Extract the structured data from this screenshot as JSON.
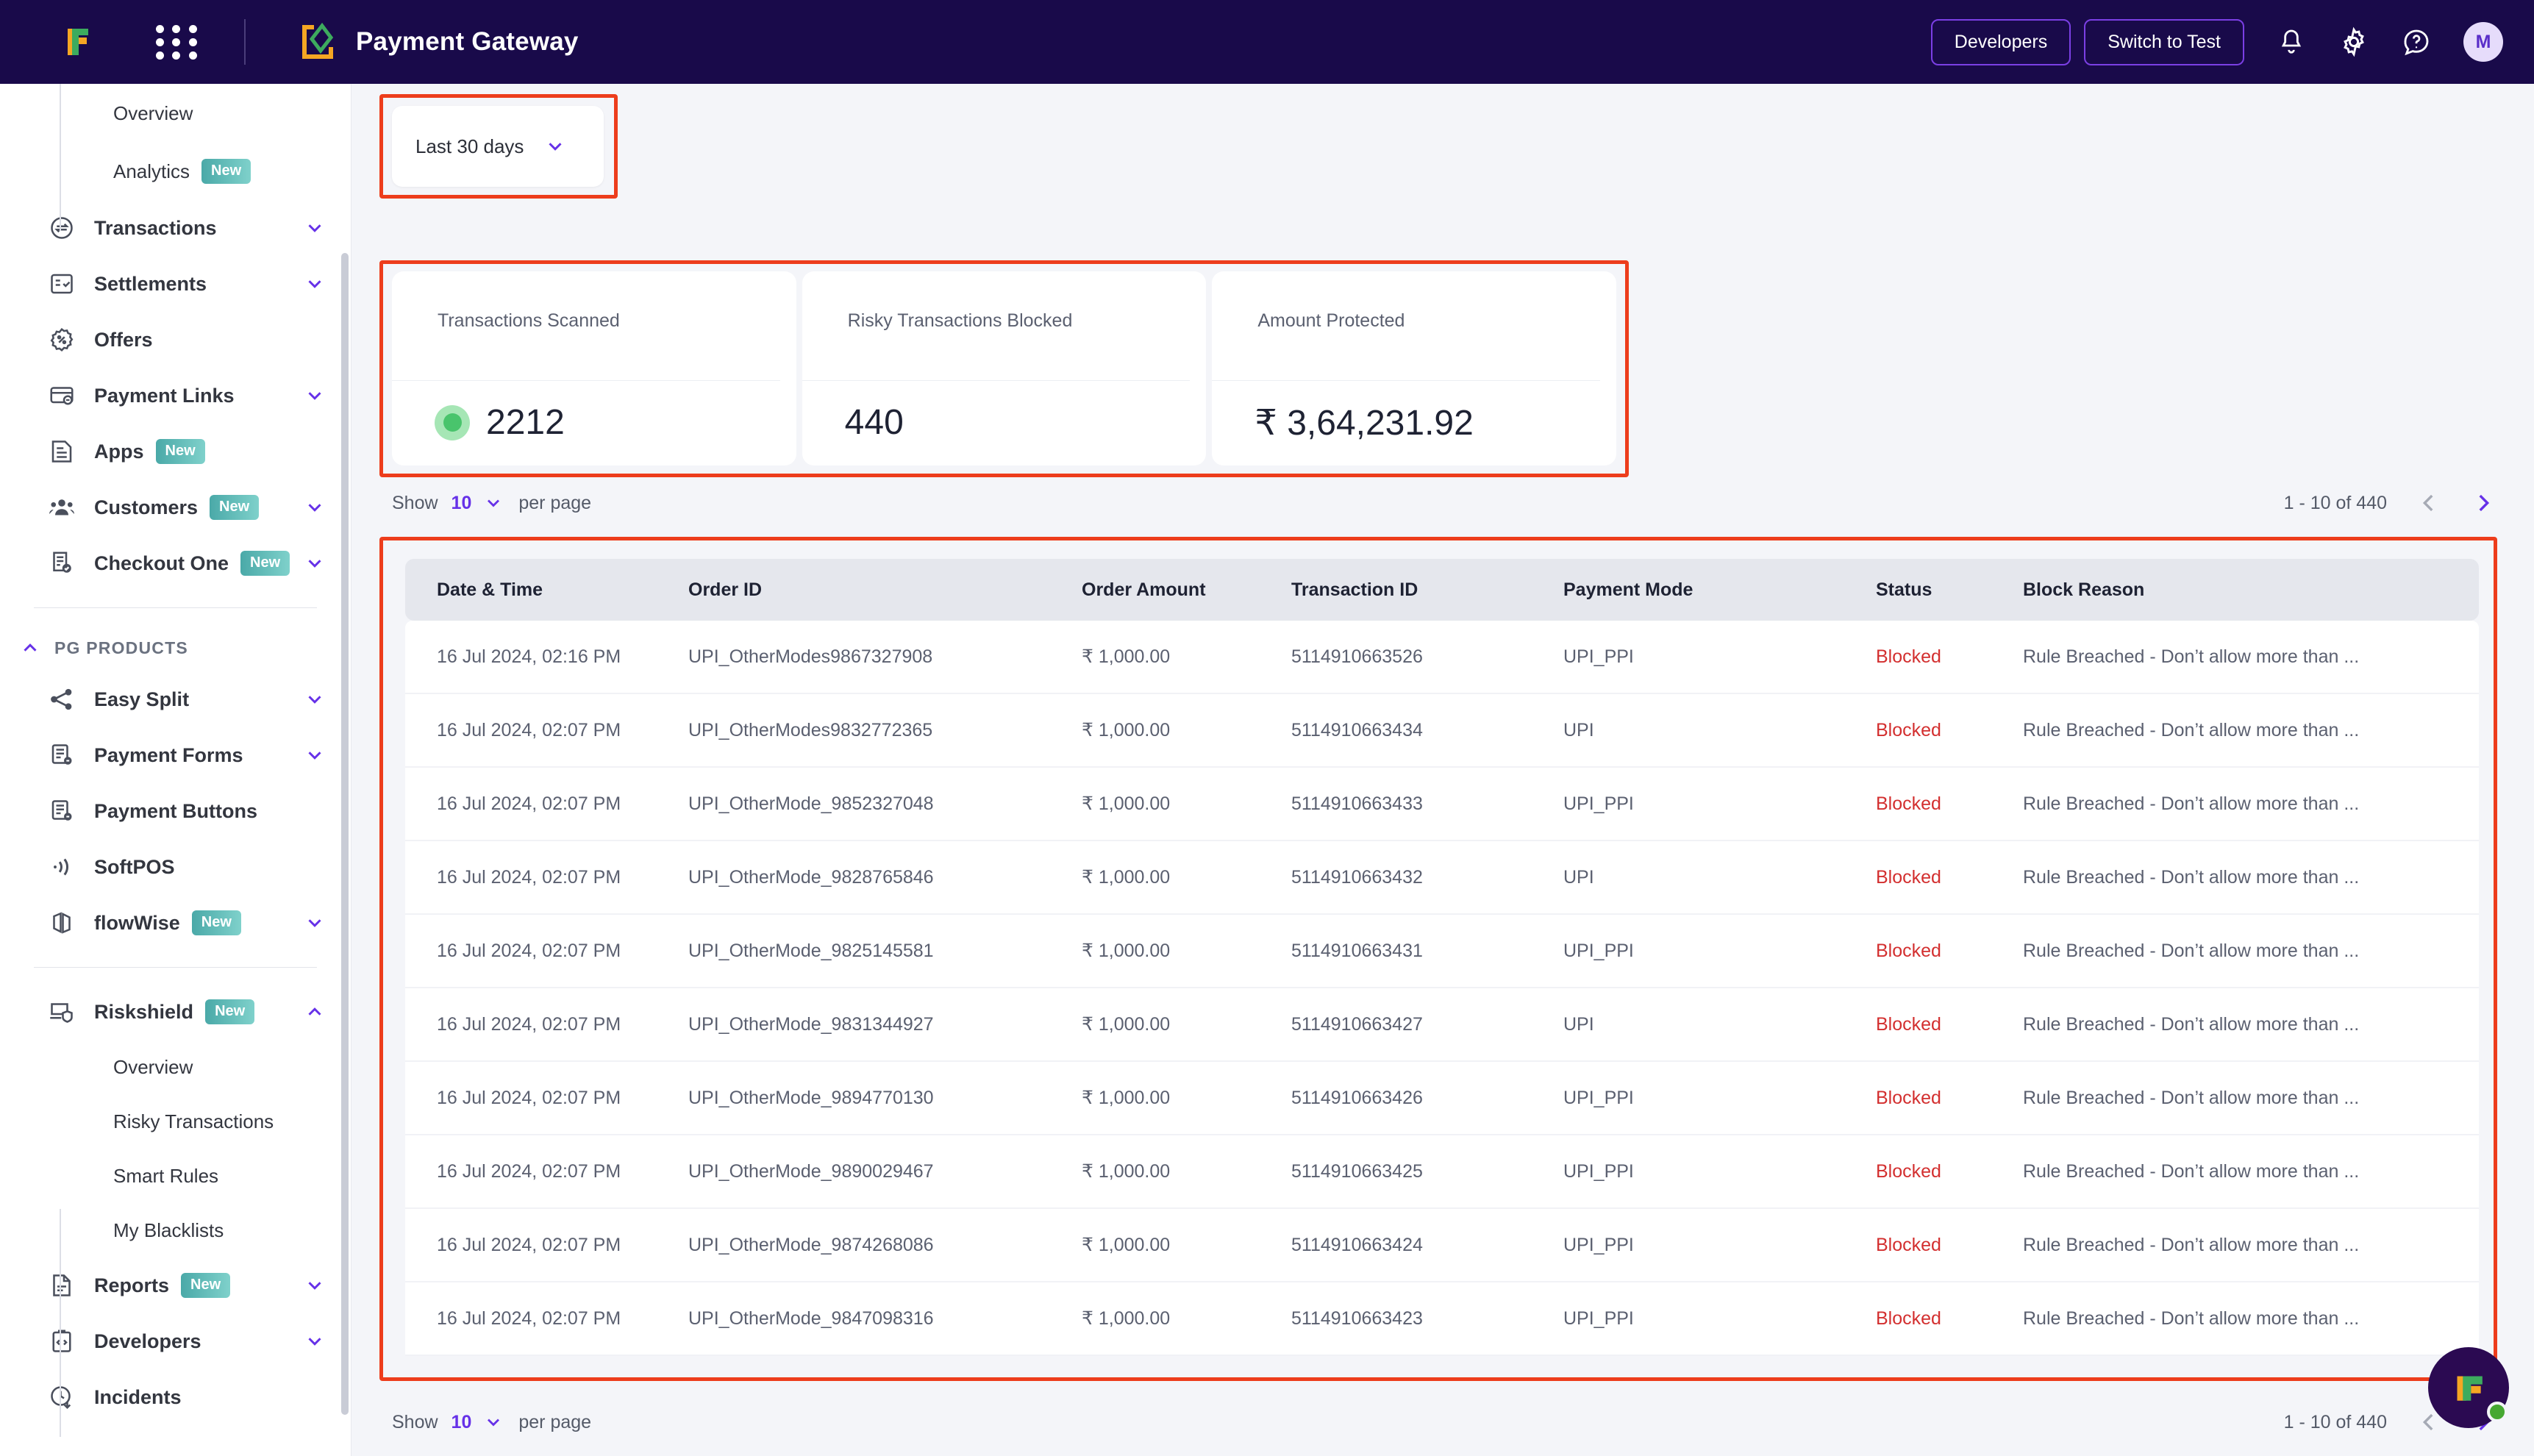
{
  "topbar": {
    "brand_icon": "flipkart-f-logo",
    "apps_grid_icon": "apps-grid-icon",
    "product_logo_icon": "payment-gateway-logo",
    "product_title": "Payment Gateway",
    "developers_label": "Developers",
    "switch_to_test_label": "Switch to Test",
    "bell_icon": "notification-bell-icon",
    "gear_icon": "settings-gear-icon",
    "help_icon": "help-question-icon",
    "avatar_initial": "M",
    "accent_purple": "#7b3fe4",
    "bar_bg": "#190A4A"
  },
  "sidebar": {
    "top_subitems": [
      {
        "label": "Overview",
        "badge": ""
      },
      {
        "label": "Analytics",
        "badge": "New"
      }
    ],
    "items": [
      {
        "label": "Transactions",
        "icon": "transactions-icon",
        "badge": "",
        "chevron": "down"
      },
      {
        "label": "Settlements",
        "icon": "settlements-icon",
        "badge": "",
        "chevron": "down"
      },
      {
        "label": "Offers",
        "icon": "offers-icon",
        "badge": "",
        "chevron": ""
      },
      {
        "label": "Payment Links",
        "icon": "payment-links-icon",
        "badge": "",
        "chevron": "down"
      },
      {
        "label": "Apps",
        "icon": "apps-icon",
        "badge": "New",
        "chevron": ""
      },
      {
        "label": "Customers",
        "icon": "customers-icon",
        "badge": "New",
        "chevron": "down"
      },
      {
        "label": "Checkout One",
        "icon": "checkout-one-icon",
        "badge": "New",
        "chevron": "down"
      }
    ],
    "section_title": "PG PRODUCTS",
    "products": [
      {
        "label": "Easy Split",
        "icon": "easy-split-icon",
        "badge": "",
        "chevron": "down"
      },
      {
        "label": "Payment Forms",
        "icon": "payment-forms-icon",
        "badge": "",
        "chevron": "down"
      },
      {
        "label": "Payment Buttons",
        "icon": "payment-buttons-icon",
        "badge": "",
        "chevron": ""
      },
      {
        "label": "SoftPOS",
        "icon": "softpos-icon",
        "badge": "",
        "chevron": ""
      },
      {
        "label": "flowWise",
        "icon": "flowwise-icon",
        "badge": "New",
        "chevron": "down"
      }
    ],
    "riskshield": {
      "label": "Riskshield",
      "icon": "riskshield-icon",
      "badge": "New",
      "chevron": "up"
    },
    "riskshield_subitems": [
      {
        "label": "Overview"
      },
      {
        "label": "Risky Transactions"
      },
      {
        "label": "Smart Rules"
      },
      {
        "label": "My Blacklists"
      }
    ],
    "bottom_items": [
      {
        "label": "Reports",
        "icon": "reports-icon",
        "badge": "New",
        "chevron": "down"
      },
      {
        "label": "Developers",
        "icon": "developers-icon",
        "badge": "",
        "chevron": "down"
      },
      {
        "label": "Incidents",
        "icon": "incidents-icon",
        "badge": "",
        "chevron": ""
      }
    ]
  },
  "main": {
    "date_filter": {
      "label": "Last 30 days",
      "chevron_icon": "chevron-down-icon"
    },
    "stats": [
      {
        "title": "Transactions Scanned",
        "value": "2212",
        "has_dot": true,
        "dot_color": "#49c46c"
      },
      {
        "title": "Risky Transactions Blocked",
        "value": "440",
        "has_dot": false
      },
      {
        "title": "Amount Protected",
        "value": "₹ 3,64,231.92",
        "has_dot": false
      }
    ],
    "pagination": {
      "show_label": "Show",
      "per_page_value": "10",
      "per_page_label": "per page",
      "range_label": "1 - 10 of 440",
      "prev_icon": "chevron-left-icon",
      "next_icon": "chevron-right-icon"
    },
    "table": {
      "columns": [
        "Date & Time",
        "Order ID",
        "Order Amount",
        "Transaction ID",
        "Payment Mode",
        "Status",
        "Block Reason"
      ],
      "rows": [
        {
          "datetime": "16 Jul 2024, 02:16 PM",
          "order_id": "UPI_OtherModes9867327908",
          "amount": "₹ 1,000.00",
          "txn_id": "5114910663526",
          "mode": "UPI_PPI",
          "status": "Blocked",
          "reason": "Rule Breached - Don’t allow more than ..."
        },
        {
          "datetime": "16 Jul 2024, 02:07 PM",
          "order_id": "UPI_OtherModes9832772365",
          "amount": "₹ 1,000.00",
          "txn_id": "5114910663434",
          "mode": "UPI",
          "status": "Blocked",
          "reason": "Rule Breached - Don’t allow more than ..."
        },
        {
          "datetime": "16 Jul 2024, 02:07 PM",
          "order_id": "UPI_OtherMode_9852327048",
          "amount": "₹ 1,000.00",
          "txn_id": "5114910663433",
          "mode": "UPI_PPI",
          "status": "Blocked",
          "reason": "Rule Breached - Don’t allow more than ..."
        },
        {
          "datetime": "16 Jul 2024, 02:07 PM",
          "order_id": "UPI_OtherMode_9828765846",
          "amount": "₹ 1,000.00",
          "txn_id": "5114910663432",
          "mode": "UPI",
          "status": "Blocked",
          "reason": "Rule Breached - Don’t allow more than ..."
        },
        {
          "datetime": "16 Jul 2024, 02:07 PM",
          "order_id": "UPI_OtherMode_9825145581",
          "amount": "₹ 1,000.00",
          "txn_id": "5114910663431",
          "mode": "UPI_PPI",
          "status": "Blocked",
          "reason": "Rule Breached - Don’t allow more than ..."
        },
        {
          "datetime": "16 Jul 2024, 02:07 PM",
          "order_id": "UPI_OtherMode_9831344927",
          "amount": "₹ 1,000.00",
          "txn_id": "5114910663427",
          "mode": "UPI",
          "status": "Blocked",
          "reason": "Rule Breached - Don’t allow more than ..."
        },
        {
          "datetime": "16 Jul 2024, 02:07 PM",
          "order_id": "UPI_OtherMode_9894770130",
          "amount": "₹ 1,000.00",
          "txn_id": "5114910663426",
          "mode": "UPI_PPI",
          "status": "Blocked",
          "reason": "Rule Breached - Don’t allow more than ..."
        },
        {
          "datetime": "16 Jul 2024, 02:07 PM",
          "order_id": "UPI_OtherMode_9890029467",
          "amount": "₹ 1,000.00",
          "txn_id": "5114910663425",
          "mode": "UPI_PPI",
          "status": "Blocked",
          "reason": "Rule Breached - Don’t allow more than ..."
        },
        {
          "datetime": "16 Jul 2024, 02:07 PM",
          "order_id": "UPI_OtherMode_9874268086",
          "amount": "₹ 1,000.00",
          "txn_id": "5114910663424",
          "mode": "UPI_PPI",
          "status": "Blocked",
          "reason": "Rule Breached - Don’t allow more than ..."
        },
        {
          "datetime": "16 Jul 2024, 02:07 PM",
          "order_id": "UPI_OtherMode_9847098316",
          "amount": "₹ 1,000.00",
          "txn_id": "5114910663423",
          "mode": "UPI_PPI",
          "status": "Blocked",
          "reason": "Rule Breached - Don’t allow more than ..."
        }
      ]
    },
    "fab": {
      "icon": "flipkart-chat-logo",
      "status_color": "#46a832"
    }
  }
}
